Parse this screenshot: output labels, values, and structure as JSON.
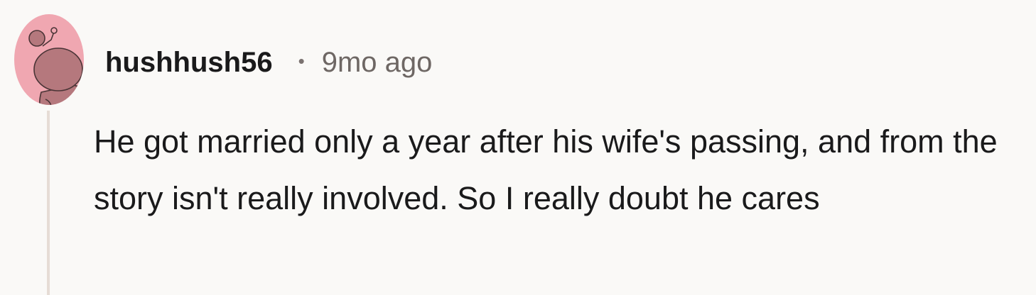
{
  "comment": {
    "author": "hushhush56",
    "separator": "•",
    "timestamp": "9mo ago",
    "body": "He got married only a year after his wife's passing, and from the story isn't really involved. So I really doubt he cares",
    "avatar_icon": "reddit-snoo-avatar-icon",
    "colors": {
      "background": "#faf9f7",
      "avatar_bg": "#f0a7b1",
      "avatar_figure": "#b5787d",
      "thread_line": "#e6dcd5",
      "text": "#1a1a1b",
      "muted": "#6e6764"
    }
  }
}
